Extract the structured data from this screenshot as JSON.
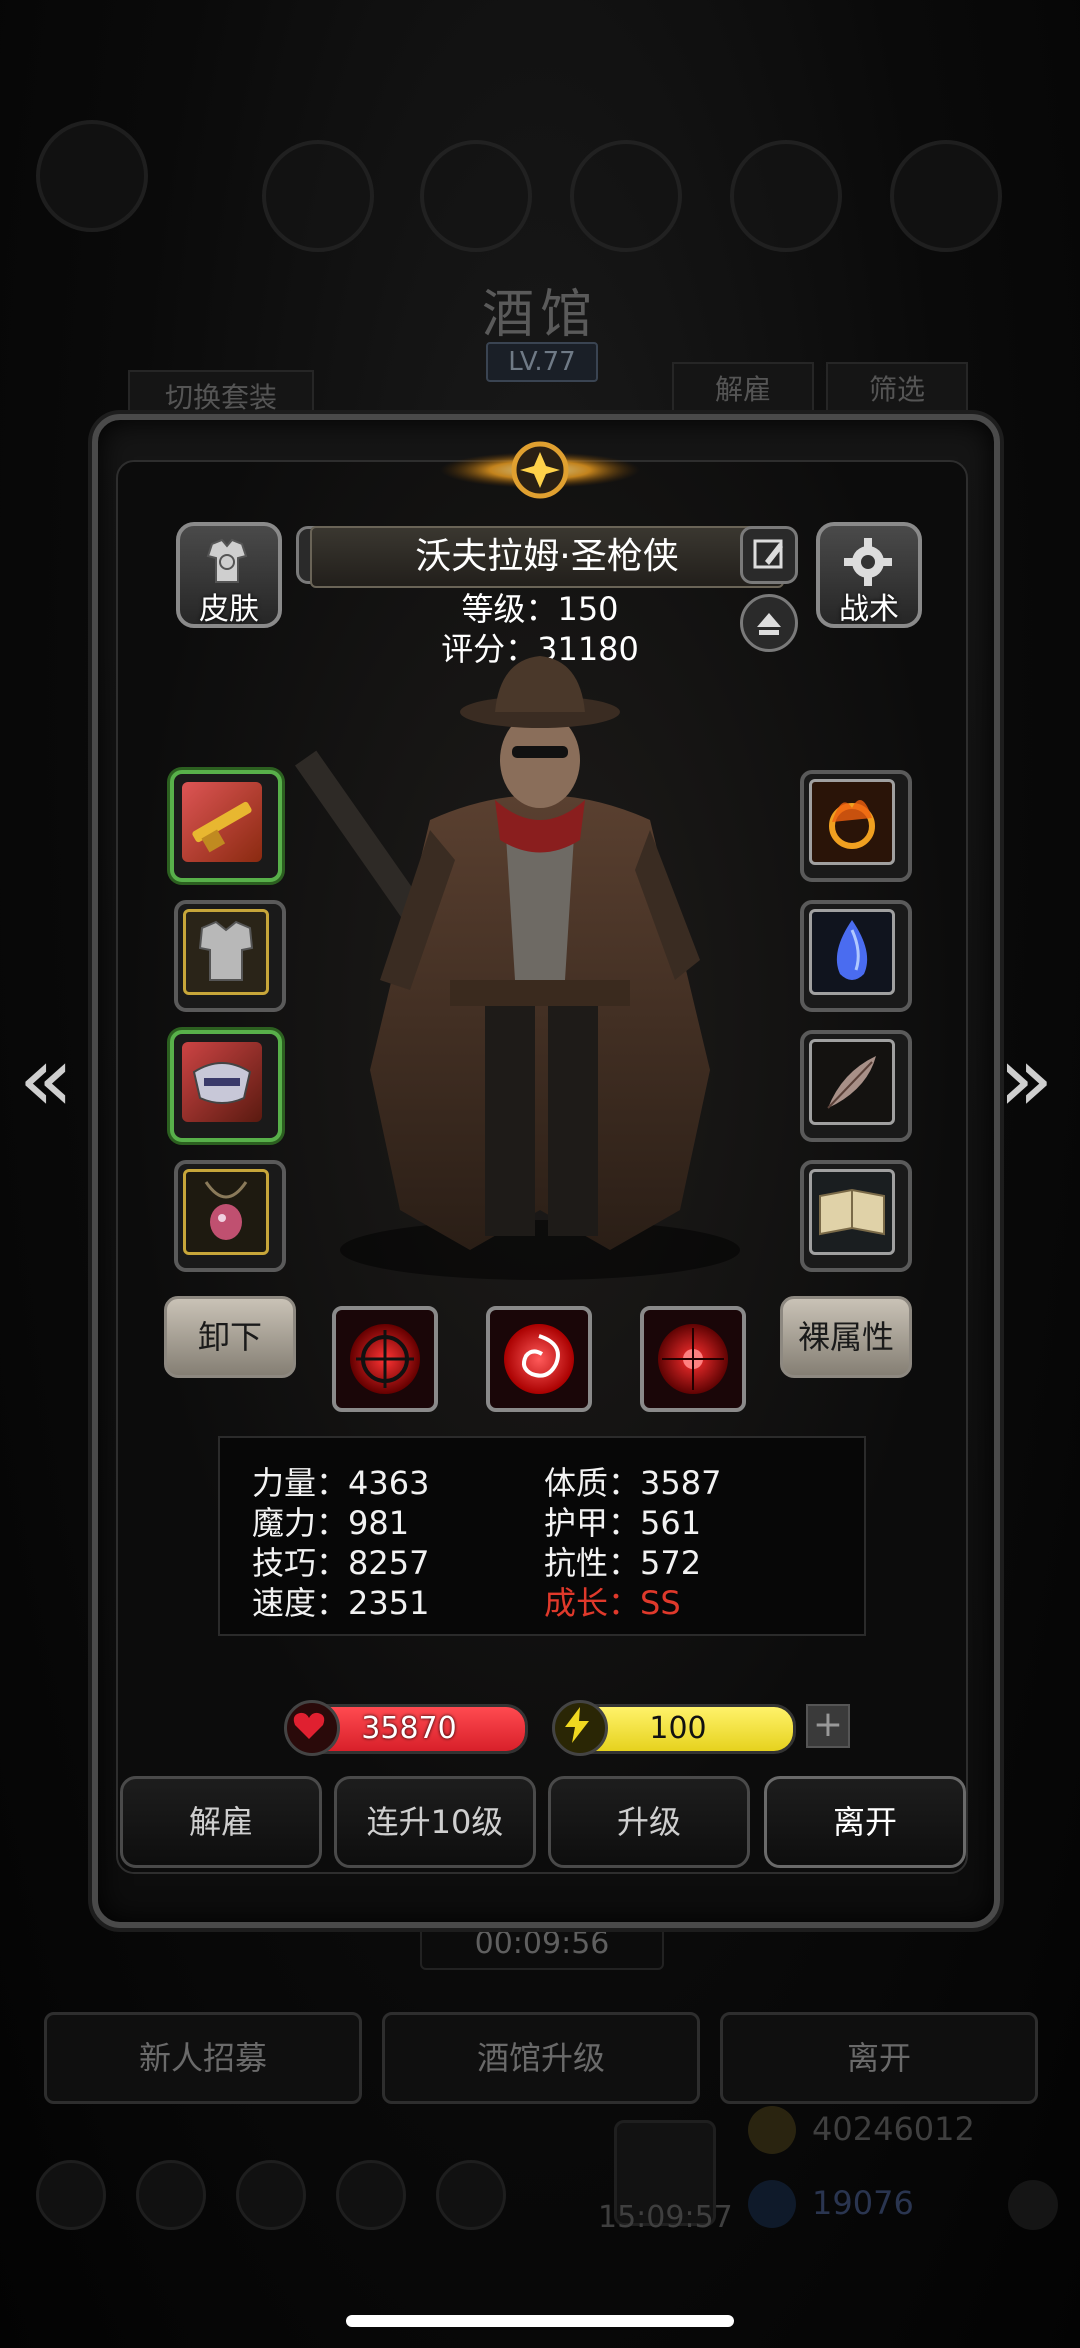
{
  "background": {
    "title": "酒馆",
    "level": "LV.77",
    "switch_outfit": "切换套装",
    "dismiss": "解雇",
    "filter": "筛选",
    "timer": "00:09:56",
    "bottom_buttons": [
      "新人招募",
      "酒馆升级",
      "离开"
    ],
    "gold": "40246012",
    "clock": "15:09:57",
    "gems": "19076"
  },
  "hero": {
    "name": "沃夫拉姆·圣枪侠",
    "level_text": "等级：150",
    "score_text": "评分：31180",
    "skin_label": "皮肤",
    "tactics_label": "战术",
    "unequip_label": "卸下",
    "base_attr_label": "裸属性"
  },
  "stats": {
    "strength": "力量：4363",
    "constitution": "体质：3587",
    "magic": "魔力：981",
    "armor": "护甲：561",
    "skill": "技巧：8257",
    "resistance": "抗性：572",
    "speed": "速度：2351",
    "growth": "成长：SS"
  },
  "vitals": {
    "hp": "35870",
    "energy": "100",
    "energy_fraction": 1.0,
    "hp_fraction": 1.0
  },
  "dialog_buttons": {
    "dismiss": "解雇",
    "level_up_10": "连升10级",
    "level_up": "升级",
    "leave": "离开"
  },
  "colors": {
    "hp_red": "#d8202a",
    "energy_yellow": "#e6d21e",
    "growth_red": "#e0392b"
  },
  "icons": {
    "left_slots": [
      "golden-rifle-icon",
      "armor-icon",
      "helmet-mask-icon",
      "amulet-icon"
    ],
    "right_slots": [
      "fire-ring-icon",
      "blue-crystal-icon",
      "feather-icon",
      "spellbook-icon"
    ],
    "skills": [
      "crosshair-skill-icon",
      "vortex-skill-icon",
      "target-skill-icon"
    ]
  }
}
